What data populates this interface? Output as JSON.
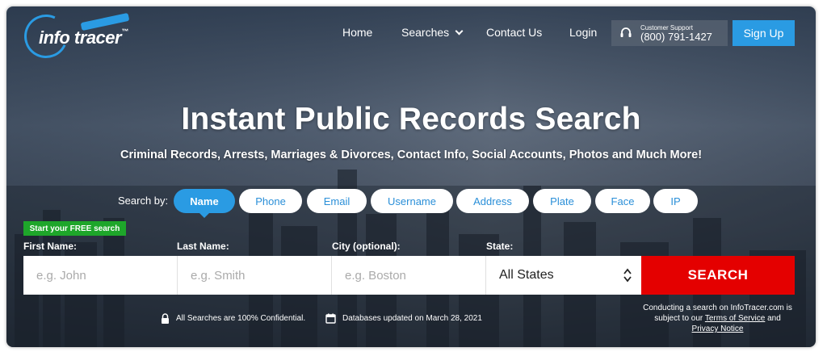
{
  "brand": {
    "logo_text": "info tracer",
    "tm": "™"
  },
  "nav": {
    "home": "Home",
    "searches": "Searches",
    "contact": "Contact Us",
    "login": "Login"
  },
  "support": {
    "label": "Customer Support",
    "phone": "(800) 791-1427"
  },
  "signup": "Sign Up",
  "hero": {
    "title": "Instant Public Records Search",
    "subtitle": "Criminal Records, Arrests, Marriages & Divorces, Contact Info, Social Accounts, Photos and Much More!"
  },
  "search_by": {
    "label": "Search by:",
    "tabs": [
      "Name",
      "Phone",
      "Email",
      "Username",
      "Address",
      "Plate",
      "Face",
      "IP"
    ],
    "active": "Name"
  },
  "form": {
    "badge": "Start your FREE search",
    "first_name": {
      "label": "First Name:",
      "placeholder": "e.g. John"
    },
    "last_name": {
      "label": "Last Name:",
      "placeholder": "e.g. Smith"
    },
    "city": {
      "label": "City (optional):",
      "placeholder": "e.g. Boston"
    },
    "state": {
      "label": "State:",
      "value": "All States"
    },
    "submit": "SEARCH"
  },
  "footer": {
    "confidential": "All Searches are 100% Confidential.",
    "updated": "Databases updated on March 28, 2021",
    "legal_pre": "Conducting a search on InfoTracer.com is subject to our",
    "terms": "Terms of Service",
    "and": "and",
    "privacy": "Privacy Notice"
  },
  "colors": {
    "accent": "#2a9be3",
    "search": "#e40000",
    "badge": "#1ea62a"
  }
}
